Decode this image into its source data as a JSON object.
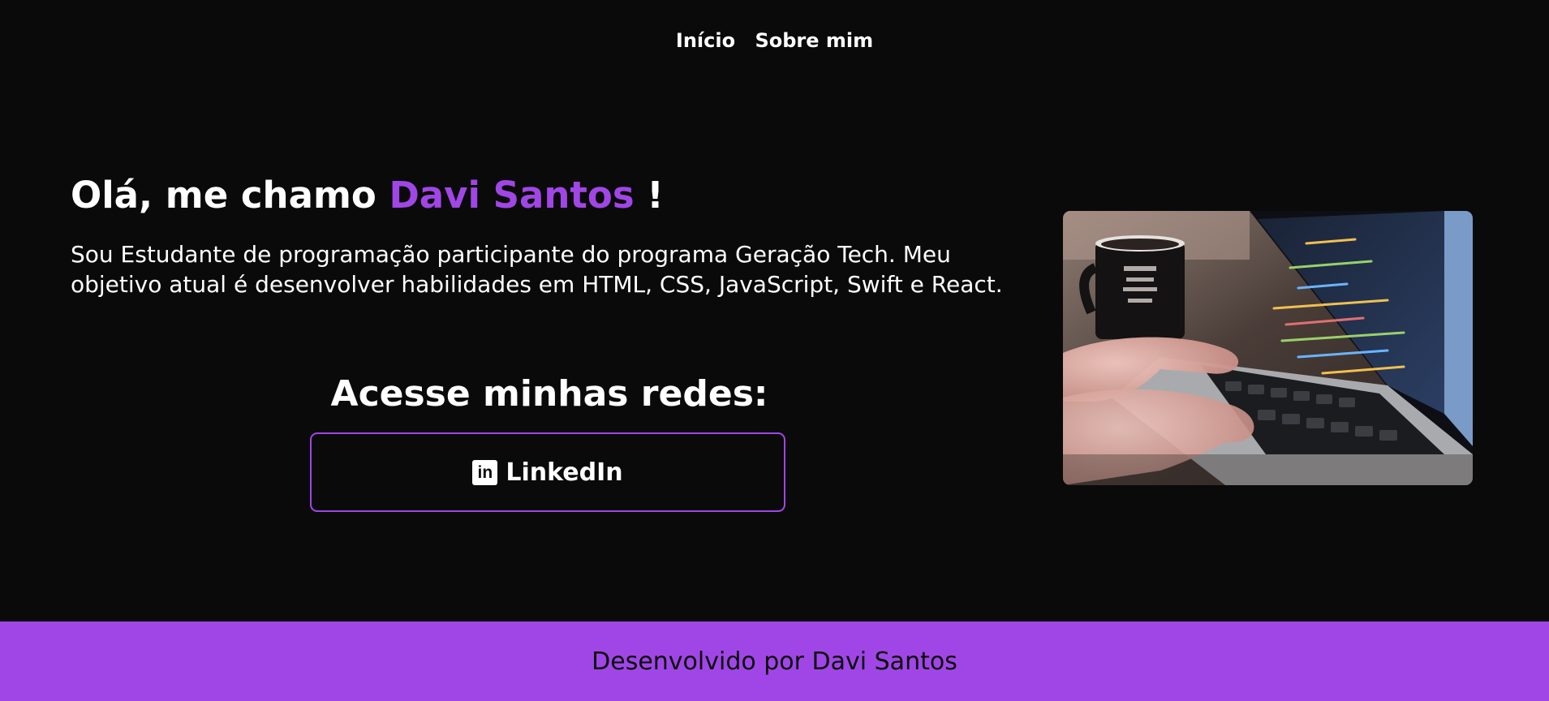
{
  "nav": {
    "items": [
      {
        "label": "Início"
      },
      {
        "label": "Sobre mim"
      }
    ]
  },
  "hero": {
    "greeting": "Olá, me chamo",
    "name": "Davi Santos",
    "exclamation": "!",
    "bio": "Sou Estudante de programação participante do programa Geração Tech. Meu objetivo atual é desenvolver habilidades em HTML, CSS, JavaScript, Swift e React."
  },
  "networks": {
    "title": "Acesse minhas redes:",
    "linkedin": {
      "label": "LinkedIn",
      "icon": "linkedin-icon",
      "icon_glyph": "in"
    }
  },
  "photo": {
    "subject": "laptop-with-code-and-typing-hands"
  },
  "footer": {
    "text": "Desenvolvido por Davi Santos"
  },
  "colors": {
    "background": "#0b0a0a",
    "accent": "#a046e6",
    "text": "#ffffff",
    "footer_text": "#0b0a0a"
  }
}
